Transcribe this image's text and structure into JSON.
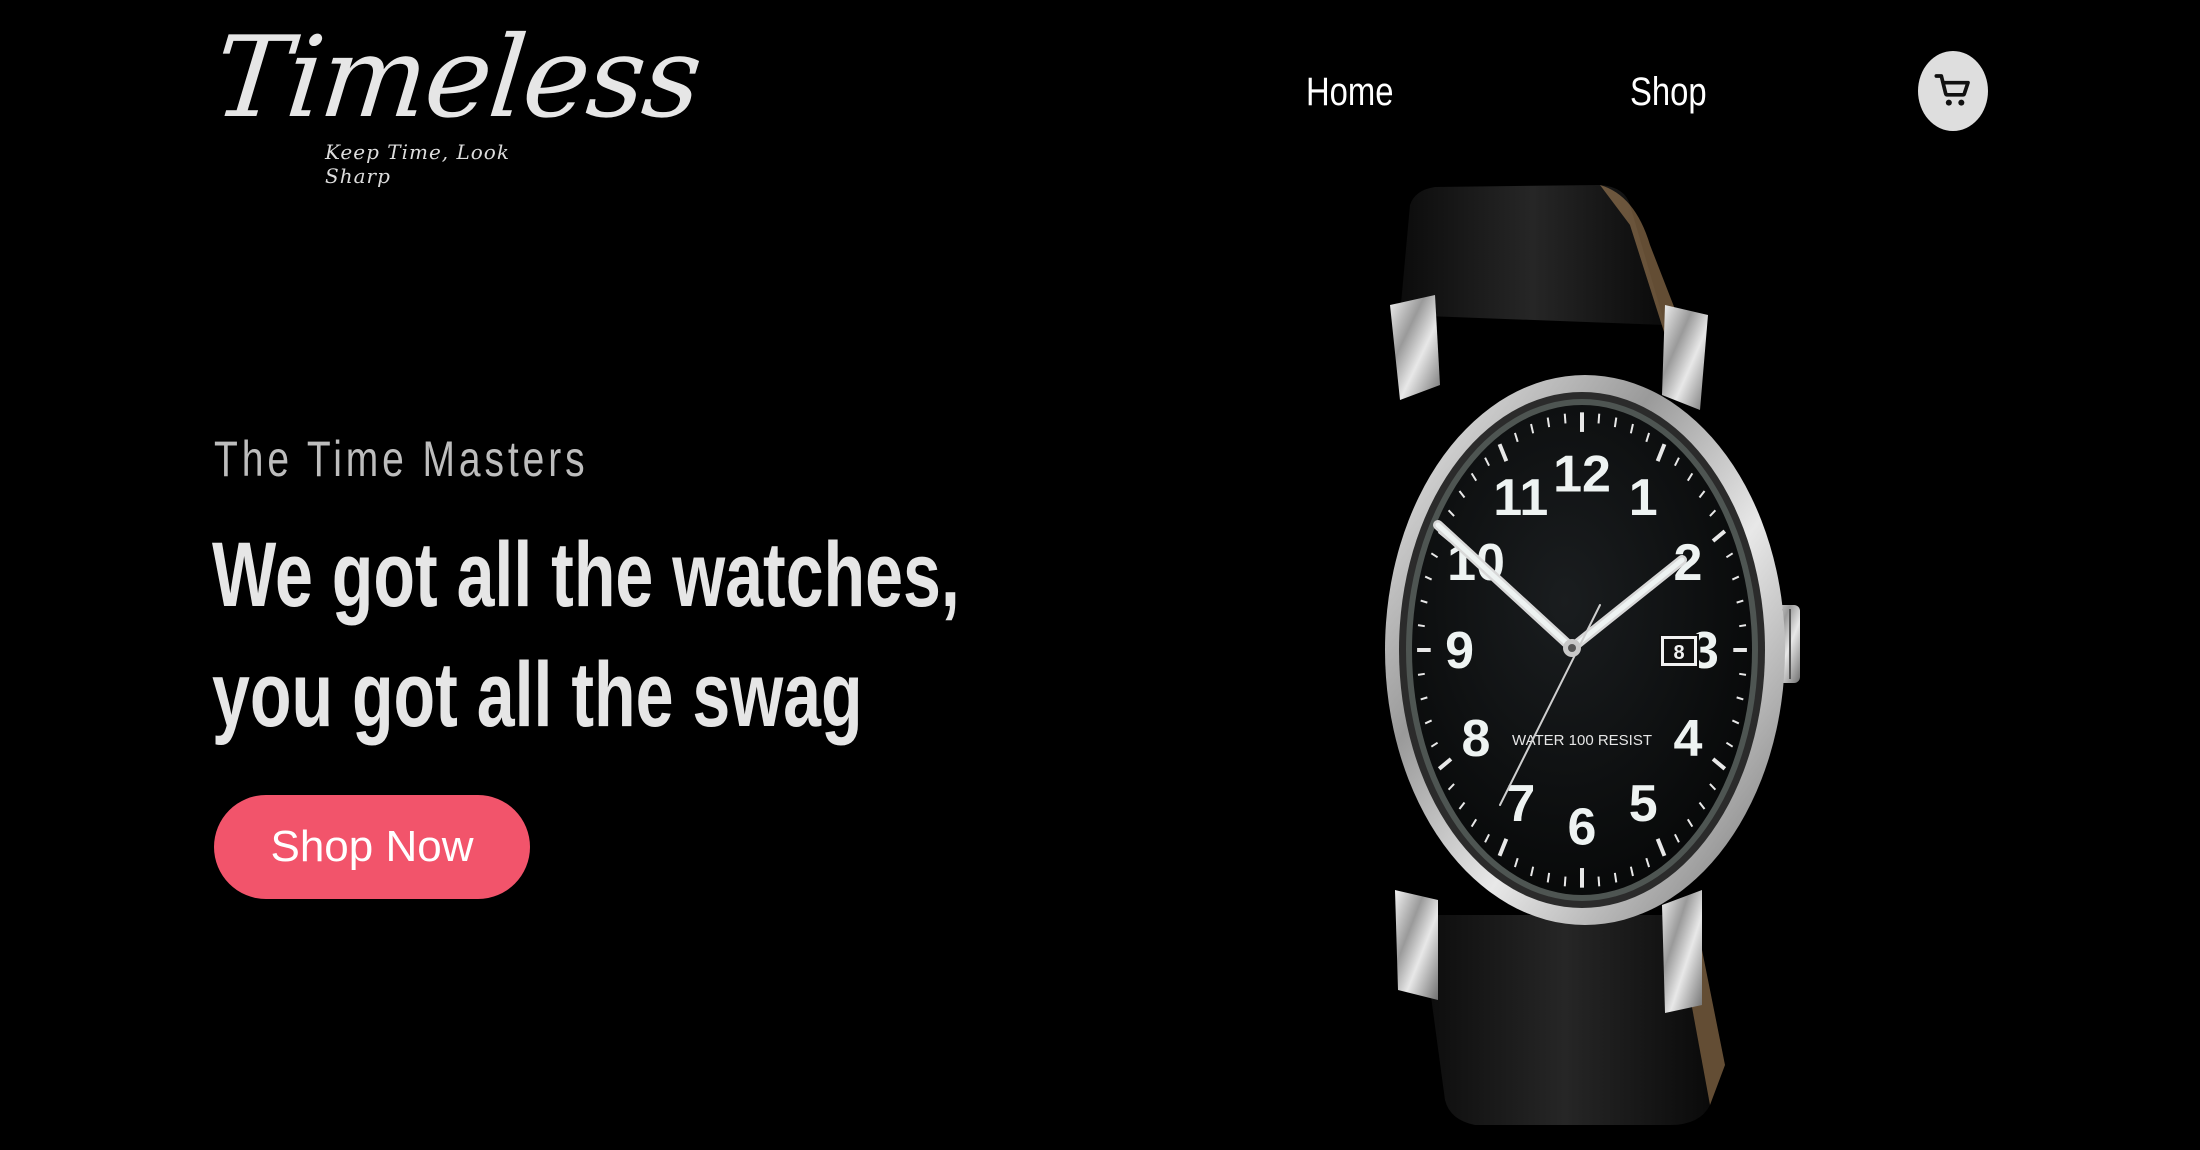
{
  "brand": {
    "name": "Timeless",
    "tagline": "Keep Time, Look Sharp"
  },
  "nav": {
    "home": "Home",
    "shop": "Shop",
    "cart_icon": "cart-icon"
  },
  "hero": {
    "eyebrow": "The Time Masters",
    "headline_line1": "We got all the watches,",
    "headline_line2": "you got all the swag",
    "cta_label": "Shop Now"
  },
  "watch": {
    "numerals": [
      "12",
      "1",
      "2",
      "3",
      "4",
      "5",
      "6",
      "7",
      "8",
      "9",
      "10",
      "11"
    ],
    "date_window": "8",
    "dial_text": "WATER 100 RESIST"
  },
  "colors": {
    "background": "#000000",
    "accent": "#f2546b",
    "cart_bg": "#dedede"
  }
}
